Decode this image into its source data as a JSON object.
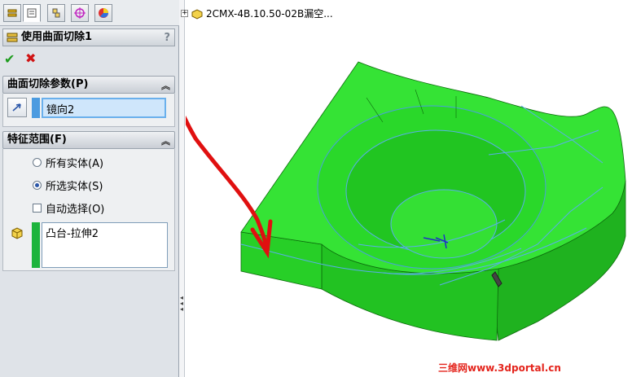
{
  "feature": {
    "title": "使用曲面切除1",
    "help": "?"
  },
  "icons": {
    "tabs": [
      "feature-manager-icon",
      "property-manager-icon",
      "configuration-manager-icon",
      "dimxpert-icon",
      "display-manager-icon"
    ],
    "ok": "✔",
    "cancel": "✖"
  },
  "sections": {
    "cut_params": {
      "title": "曲面切除参数(P)",
      "selection": "镜向2",
      "color": "#4b9be0"
    },
    "feature_scope": {
      "title": "特征范围(F)",
      "options": [
        {
          "label": "所有实体(A)",
          "selected": false
        },
        {
          "label": "所选实体(S)",
          "selected": true
        }
      ],
      "auto_select": "自动选择(O)",
      "auto_select_checked": false,
      "bodies_selection": "凸台-拉伸2",
      "color": "#1db43c"
    }
  },
  "tree": {
    "root_label": "2CMX-4B.10.50-02B漏空..."
  },
  "watermark": "三维网www.3dportal.cn",
  "colors": {
    "model_green": "#2fe22f",
    "model_dark": "#1aa81a",
    "edge_blue": "#5aaeea",
    "annotation_red": "#e01010"
  }
}
